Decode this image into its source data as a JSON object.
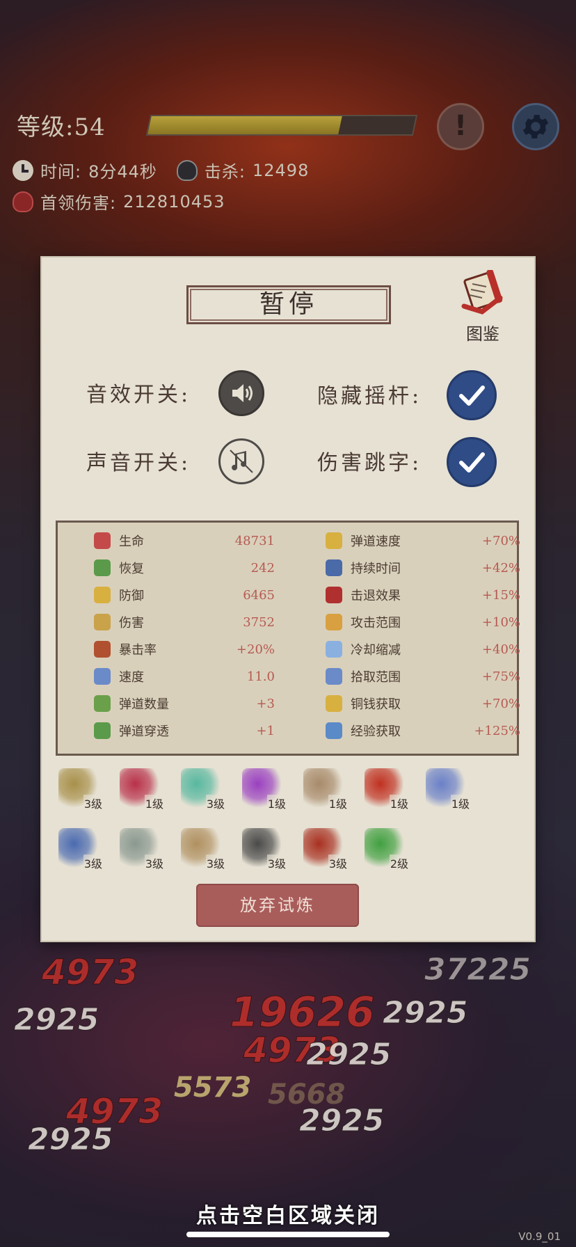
{
  "hud": {
    "level_text": "等级:54",
    "xp_progress": 0.72,
    "time_label": "时间:",
    "time_value": "8分44秒",
    "kills_label": "击杀:",
    "kills_value": "12498",
    "boss_damage_label": "首领伤害:",
    "boss_damage_value": "212810453",
    "alert_glyph": "!",
    "icons": [
      "clock-icon",
      "skull-icon",
      "red-skull-icon",
      "alert-icon",
      "gear-icon"
    ]
  },
  "damage_numbers": [
    "4973",
    "2925",
    "19626",
    "4973",
    "2925",
    "5573",
    "5668",
    "4973",
    "2925",
    "2925",
    "37225",
    "2925"
  ],
  "panel": {
    "title": "暂停",
    "book_label": "图鉴",
    "sound_effect_label": "音效开关:",
    "sound_label": "声音开关:",
    "hide_joystick_label": "隐藏摇杆:",
    "damage_numbers_label": "伤害跳字:",
    "sound_effect_on": true,
    "sound_on": false,
    "hide_joystick_checked": true,
    "damage_numbers_checked": true,
    "colors": {
      "check_blue": "#2f4c86",
      "value_red": "#b55a52",
      "panel_bg": "#e6e1d3"
    }
  },
  "stats_left": [
    {
      "name": "生命",
      "value": "48731",
      "icon": "heart-icon",
      "color": "#c44a4a"
    },
    {
      "name": "恢复",
      "value": "242",
      "icon": "plus-icon",
      "color": "#5a9a4a"
    },
    {
      "name": "防御",
      "value": "6465",
      "icon": "helmet-icon",
      "color": "#d8b040"
    },
    {
      "name": "伤害",
      "value": "3752",
      "icon": "dagger-icon",
      "color": "#c9a24a"
    },
    {
      "name": "暴击率",
      "value": "+20%",
      "icon": "crit-icon",
      "color": "#b05030"
    },
    {
      "name": "速度",
      "value": "11.0",
      "icon": "boot-icon",
      "color": "#6a8ac8"
    },
    {
      "name": "弹道数量",
      "value": "+3",
      "icon": "arrows-icon",
      "color": "#6aa04a"
    },
    {
      "name": "弹道穿透",
      "value": "+1",
      "icon": "pierce-icon",
      "color": "#5a9a4a"
    }
  ],
  "stats_right": [
    {
      "name": "弹道速度",
      "value": "+70%",
      "icon": "projectile-speed-icon",
      "color": "#d8b040"
    },
    {
      "name": "持续时间",
      "value": "+42%",
      "icon": "hourglass-icon",
      "color": "#4a6aa8"
    },
    {
      "name": "击退效果",
      "value": "+15%",
      "icon": "fist-icon",
      "color": "#b03030"
    },
    {
      "name": "攻击范围",
      "value": "+10%",
      "icon": "target-icon",
      "color": "#d8a040"
    },
    {
      "name": "冷却缩减",
      "value": "+40%",
      "icon": "snowflake-icon",
      "color": "#8ab0e0"
    },
    {
      "name": "拾取范围",
      "value": "+75%",
      "icon": "magnet-icon",
      "color": "#6a8ac8"
    },
    {
      "name": "铜钱获取",
      "value": "+70%",
      "icon": "coin-icon",
      "color": "#d8b040"
    },
    {
      "name": "经验获取",
      "value": "+125%",
      "icon": "scroll-icon",
      "color": "#5a8ac8"
    }
  ],
  "items_row1": [
    {
      "level": "3级",
      "icon": "bell-icon",
      "color": "#a8904a"
    },
    {
      "level": "1级",
      "icon": "red-ribbon-icon",
      "color": "#b8304a"
    },
    {
      "level": "3级",
      "icon": "lotus-icon",
      "color": "#58b8a0"
    },
    {
      "level": "1级",
      "icon": "scythe-icon",
      "color": "#9a40c0"
    },
    {
      "level": "1级",
      "icon": "bow-icon",
      "color": "#a88a6a"
    },
    {
      "level": "1级",
      "icon": "talisman-icon",
      "color": "#c03020"
    },
    {
      "level": "1级",
      "icon": "sword-icon",
      "color": "#6a80c8"
    }
  ],
  "items_row2": [
    {
      "level": "3级",
      "icon": "blue-crystal-icon",
      "color": "#4a6ab0"
    },
    {
      "level": "3级",
      "icon": "cleaver-icon",
      "color": "#8a9890"
    },
    {
      "level": "3级",
      "icon": "ginseng-icon",
      "color": "#b09060"
    },
    {
      "level": "3级",
      "icon": "dart-icon",
      "color": "#4a4a4a"
    },
    {
      "level": "3级",
      "icon": "fang-necklace-icon",
      "color": "#a83020"
    },
    {
      "level": "2级",
      "icon": "jade-ring-icon",
      "color": "#40a040"
    }
  ],
  "quit_button": "放弃试炼",
  "close_hint": "点击空白区域关闭",
  "version": "V0.9_01"
}
